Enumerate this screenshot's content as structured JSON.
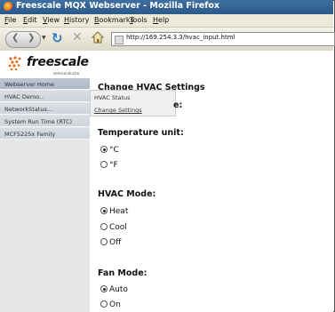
{
  "window": {
    "title": "Freescale MQX Webserver - Mozilla Firefox"
  },
  "menu": {
    "items": [
      {
        "label": "File",
        "key": "F",
        "rest": "ile"
      },
      {
        "label": "Edit",
        "key": "E",
        "rest": "dit"
      },
      {
        "label": "View",
        "key": "V",
        "rest": "iew"
      },
      {
        "label": "History",
        "key": "H",
        "rest": "istory"
      },
      {
        "label": "Bookmarks",
        "key": "B",
        "rest": "ookmarks"
      },
      {
        "label": "Tools",
        "key": "T",
        "rest": "ools"
      },
      {
        "label": "Help",
        "key": "H",
        "rest": "elp"
      }
    ]
  },
  "toolbar": {
    "url": "http://169.254.3.3/hvac_input.html"
  },
  "logo": {
    "word": "freescale",
    "sub": "semiconductor"
  },
  "sidebar": {
    "items": [
      {
        "label": "Webserver Home"
      },
      {
        "label": "HVAC Demo..."
      },
      {
        "label": "NetworkStatus..."
      },
      {
        "label": "System Run Time (RTC)"
      },
      {
        "label": "MCF5225x Family"
      }
    ]
  },
  "submenu": {
    "items": [
      {
        "label": "HVAC Status"
      },
      {
        "label": "Change Settings"
      }
    ]
  },
  "page": {
    "title": "Change HVAC Settings",
    "title_tail": "e:",
    "temp_unit": {
      "label": "Temperature unit:",
      "options": [
        {
          "label": "°C",
          "selected": true
        },
        {
          "label": "°F",
          "selected": false
        }
      ]
    },
    "hvac_mode": {
      "label": "HVAC Mode:",
      "options": [
        {
          "label": "Heat",
          "selected": true
        },
        {
          "label": "Cool",
          "selected": false
        },
        {
          "label": "Off",
          "selected": false
        }
      ]
    },
    "fan_mode": {
      "label": "Fan Mode:",
      "options": [
        {
          "label": "Auto",
          "selected": true
        },
        {
          "label": "On",
          "selected": false
        }
      ]
    }
  },
  "colors": {
    "titlebar": "#2b5a8a",
    "sidebar": "#d5dae1",
    "submenu": "#eef0f2"
  }
}
